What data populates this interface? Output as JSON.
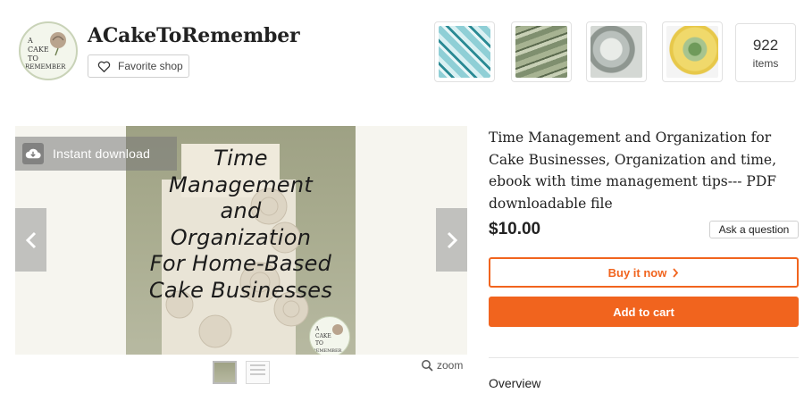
{
  "shop": {
    "name": "ACakeToRemember",
    "favorite_label": "Favorite shop",
    "logo_text": [
      "A",
      "CAKE",
      "TO",
      "REMEMBER"
    ]
  },
  "featured_thumbs": [
    {
      "icon": "butterfly-decoration-thumbnail"
    },
    {
      "icon": "money-print-thumbnail"
    },
    {
      "icon": "crystal-decoration-thumbnail"
    },
    {
      "icon": "succulent-mold-thumbnail"
    }
  ],
  "items": {
    "count": "922",
    "label": "items"
  },
  "gallery": {
    "instant_label": "Instant download",
    "cover_lines": [
      "Time",
      "Management",
      "and",
      "Organization",
      "For Home-Based",
      "Cake Businesses"
    ],
    "badge_text": [
      "A",
      "CAKE",
      "TO",
      "REMEMBER"
    ],
    "zoom_label": "zoom"
  },
  "listing": {
    "title": "Time Management and Organization for Cake Businesses, Organization and time, ebook with time management tips--- PDF downloadable file",
    "price": "$10.00",
    "ask_label": "Ask a question",
    "buy_label": "Buy it now",
    "cart_label": "Add to cart",
    "overview_label": "Overview"
  },
  "colors": {
    "accent": "#f1641e",
    "cover_bg": "#a9ac8f"
  }
}
